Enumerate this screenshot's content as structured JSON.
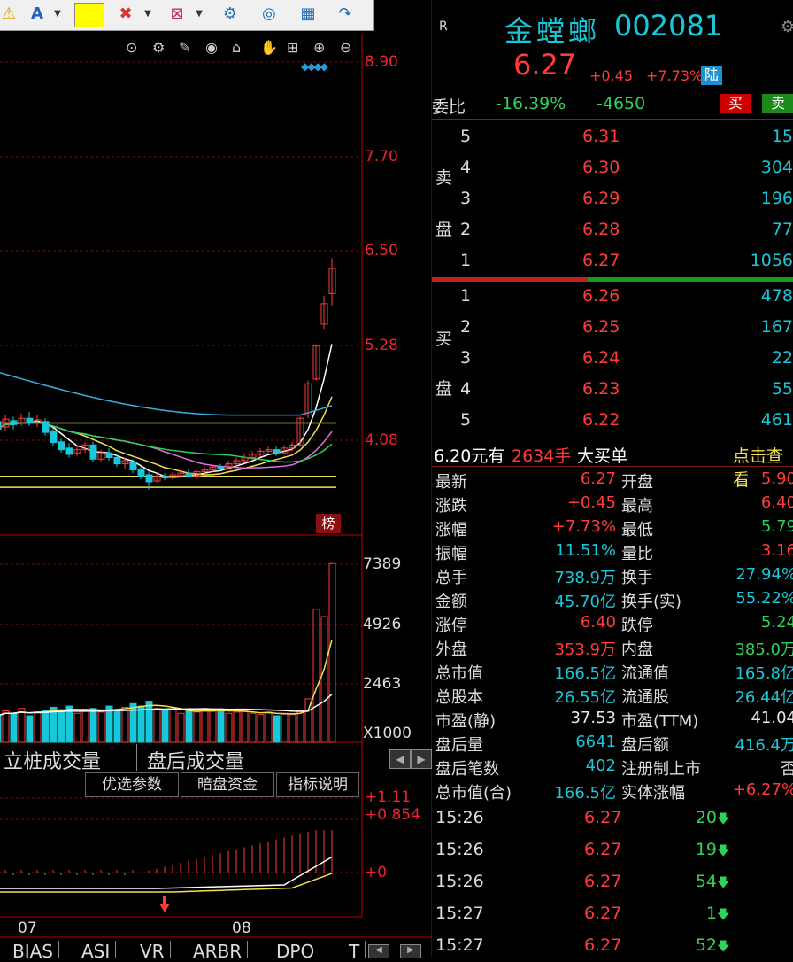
{
  "toolbar": {
    "items": [
      "A",
      "",
      "",
      "",
      "",
      "",
      "",
      ""
    ]
  },
  "chart": {
    "price_axis": [
      "8.90",
      "7.70",
      "6.50",
      "5.28",
      "4.08"
    ],
    "flag_label": "榜",
    "volume_axis": [
      "7389",
      "4926",
      "2463",
      "X1000"
    ],
    "volume_tabs": [
      "立桩成交量",
      "盘后成交量"
    ],
    "indicator_buttons": [
      "优选参数",
      "暗盘资金",
      "指标说明"
    ],
    "macd_axis": [
      "+1.11",
      "+0.854",
      "+0"
    ],
    "months": [
      "07",
      "08"
    ],
    "bottom_tabs": [
      "BIAS",
      "ASI",
      "VR",
      "ARBR",
      "DPO",
      "T"
    ],
    "colors": {
      "up": "#ff3b3b",
      "down": "#18c8d8",
      "ma5": "#ffffff",
      "ma10": "#f0e050",
      "ma20": "#e070e0",
      "ma30": "#2fd35a",
      "ma60": "#3ab0e0"
    },
    "chart_data": {
      "type": "candlestick",
      "price_ylim": [
        3.4,
        9.2
      ],
      "volume_ylim": [
        0,
        7800
      ],
      "candles": [
        {
          "o": 4.32,
          "c": 4.22,
          "h": 4.4,
          "l": 4.15
        },
        {
          "o": 4.25,
          "c": 4.35,
          "h": 4.4,
          "l": 4.2
        },
        {
          "o": 4.33,
          "c": 4.28,
          "h": 4.38,
          "l": 4.22
        },
        {
          "o": 4.3,
          "c": 4.36,
          "h": 4.42,
          "l": 4.26
        },
        {
          "o": 4.36,
          "c": 4.3,
          "h": 4.44,
          "l": 4.26
        },
        {
          "o": 4.3,
          "c": 4.34,
          "h": 4.4,
          "l": 4.25
        },
        {
          "o": 4.32,
          "c": 4.18,
          "h": 4.36,
          "l": 4.14
        },
        {
          "o": 4.2,
          "c": 4.05,
          "h": 4.24,
          "l": 4.0
        },
        {
          "o": 4.06,
          "c": 3.96,
          "h": 4.1,
          "l": 3.92
        },
        {
          "o": 3.98,
          "c": 3.9,
          "h": 4.04,
          "l": 3.86
        },
        {
          "o": 3.92,
          "c": 3.96,
          "h": 4.02,
          "l": 3.88
        },
        {
          "o": 3.96,
          "c": 4.02,
          "h": 4.06,
          "l": 3.92
        },
        {
          "o": 4.02,
          "c": 3.84,
          "h": 4.06,
          "l": 3.8
        },
        {
          "o": 3.84,
          "c": 3.92,
          "h": 3.96,
          "l": 3.8
        },
        {
          "o": 3.92,
          "c": 3.86,
          "h": 3.98,
          "l": 3.82
        },
        {
          "o": 3.86,
          "c": 3.78,
          "h": 3.9,
          "l": 3.74
        },
        {
          "o": 3.78,
          "c": 3.82,
          "h": 3.86,
          "l": 3.72
        },
        {
          "o": 3.8,
          "c": 3.7,
          "h": 3.84,
          "l": 3.66
        },
        {
          "o": 3.7,
          "c": 3.62,
          "h": 3.74,
          "l": 3.58
        },
        {
          "o": 3.64,
          "c": 3.55,
          "h": 3.68,
          "l": 3.45
        },
        {
          "o": 3.56,
          "c": 3.62,
          "h": 3.66,
          "l": 3.54
        },
        {
          "o": 3.62,
          "c": 3.6,
          "h": 3.66,
          "l": 3.57
        },
        {
          "o": 3.6,
          "c": 3.64,
          "h": 3.68,
          "l": 3.58
        },
        {
          "o": 3.63,
          "c": 3.66,
          "h": 3.7,
          "l": 3.6
        },
        {
          "o": 3.66,
          "c": 3.62,
          "h": 3.7,
          "l": 3.6
        },
        {
          "o": 3.62,
          "c": 3.68,
          "h": 3.72,
          "l": 3.6
        },
        {
          "o": 3.68,
          "c": 3.7,
          "h": 3.74,
          "l": 3.65
        },
        {
          "o": 3.7,
          "c": 3.74,
          "h": 3.78,
          "l": 3.67
        },
        {
          "o": 3.74,
          "c": 3.72,
          "h": 3.78,
          "l": 3.7
        },
        {
          "o": 3.72,
          "c": 3.78,
          "h": 3.82,
          "l": 3.7
        },
        {
          "o": 3.78,
          "c": 3.82,
          "h": 3.86,
          "l": 3.75
        },
        {
          "o": 3.82,
          "c": 3.86,
          "h": 3.9,
          "l": 3.79
        },
        {
          "o": 3.86,
          "c": 3.9,
          "h": 3.94,
          "l": 3.83
        },
        {
          "o": 3.9,
          "c": 3.94,
          "h": 3.98,
          "l": 3.87
        },
        {
          "o": 3.94,
          "c": 3.96,
          "h": 4.0,
          "l": 3.9
        },
        {
          "o": 3.96,
          "c": 3.92,
          "h": 4.0,
          "l": 3.88
        },
        {
          "o": 3.92,
          "c": 3.98,
          "h": 4.02,
          "l": 3.9
        },
        {
          "o": 3.98,
          "c": 4.02,
          "h": 4.06,
          "l": 3.94
        },
        {
          "o": 4.02,
          "c": 4.36,
          "h": 4.38,
          "l": 4.0
        },
        {
          "o": 4.4,
          "c": 4.8,
          "h": 4.84,
          "l": 4.36
        },
        {
          "o": 4.86,
          "c": 5.28,
          "h": 5.3,
          "l": 4.84
        },
        {
          "o": 5.56,
          "c": 5.82,
          "h": 5.92,
          "l": 5.5
        },
        {
          "o": 5.95,
          "c": 6.27,
          "h": 6.4,
          "l": 5.79
        }
      ],
      "volumes": [
        1100,
        1300,
        1200,
        1400,
        1100,
        1250,
        1300,
        1450,
        1350,
        1500,
        1200,
        1300,
        1400,
        1250,
        1500,
        1350,
        1450,
        1600,
        1500,
        1700,
        1400,
        1300,
        1350,
        1200,
        1300,
        1250,
        1400,
        1300,
        1350,
        1200,
        1250,
        1300,
        1200,
        1150,
        1250,
        1100,
        1200,
        1150,
        1300,
        1800,
        5500,
        5200,
        7389
      ],
      "horizontal_lines": [
        4.3,
        3.62,
        3.48
      ]
    }
  },
  "quote": {
    "marker": "R",
    "name": "金螳螂",
    "code": "002081",
    "price": "6.27",
    "change": "+0.45",
    "change_pct": "+7.73%",
    "badge": "陆",
    "webi_label": "委比",
    "webi_pct": "-16.39%",
    "webi_diff": "-4650",
    "buy_btn": "买",
    "sell_btn": "卖",
    "sell_side_label": [
      "卖",
      "盘"
    ],
    "buy_side_label": [
      "买",
      "盘"
    ],
    "asks": [
      {
        "lvl": "5",
        "price": "6.31",
        "vol": "15"
      },
      {
        "lvl": "4",
        "price": "6.30",
        "vol": "304"
      },
      {
        "lvl": "3",
        "price": "6.29",
        "vol": "196"
      },
      {
        "lvl": "2",
        "price": "6.28",
        "vol": "77"
      },
      {
        "lvl": "1",
        "price": "6.27",
        "vol": "1056"
      }
    ],
    "bids": [
      {
        "lvl": "1",
        "price": "6.26",
        "vol": "478"
      },
      {
        "lvl": "2",
        "price": "6.25",
        "vol": "167"
      },
      {
        "lvl": "3",
        "price": "6.24",
        "vol": "22"
      },
      {
        "lvl": "4",
        "price": "6.23",
        "vol": "55"
      },
      {
        "lvl": "5",
        "price": "6.22",
        "vol": "461"
      }
    ],
    "big_order": {
      "a": "6.20元有",
      "b": "2634手",
      "c": "大买单",
      "d": "点击查看"
    },
    "stats": [
      {
        "l": "最新",
        "v": "6.27",
        "vc": "red",
        "l2": "开盘",
        "v2": "5.90",
        "v2c": "red"
      },
      {
        "l": "涨跌",
        "v": "+0.45",
        "vc": "red",
        "l2": "最高",
        "v2": "6.40",
        "v2c": "red"
      },
      {
        "l": "涨幅",
        "v": "+7.73%",
        "vc": "red",
        "l2": "最低",
        "v2": "5.79",
        "v2c": "green"
      },
      {
        "l": "振幅",
        "v": "11.51%",
        "vc": "cyan",
        "l2": "量比",
        "v2": "3.16",
        "v2c": "red"
      },
      {
        "l": "总手",
        "v": "738.9万",
        "vc": "cyan",
        "l2": "换手",
        "v2": "27.94%",
        "v2c": "cyan"
      },
      {
        "l": "金额",
        "v": "45.70亿",
        "vc": "cyan",
        "l2": "换手(实)",
        "v2": "55.22%",
        "v2c": "cyan"
      },
      {
        "l": "涨停",
        "v": "6.40",
        "vc": "red",
        "l2": "跌停",
        "v2": "5.24",
        "v2c": "green"
      },
      {
        "l": "外盘",
        "v": "353.9万",
        "vc": "red",
        "l2": "内盘",
        "v2": "385.0万",
        "v2c": "green"
      },
      {
        "l": "总市值",
        "v": "166.5亿",
        "vc": "cyan",
        "l2": "流通值",
        "v2": "165.8亿",
        "v2c": "cyan"
      },
      {
        "l": "总股本",
        "v": "26.55亿",
        "vc": "cyan",
        "l2": "流通股",
        "v2": "26.44亿",
        "v2c": "cyan"
      },
      {
        "l": "市盈(静)",
        "v": "37.53",
        "vc": "white",
        "l2": "市盈(TTM)",
        "v2": "41.04",
        "v2c": "white"
      },
      {
        "l": "盘后量",
        "v": "6641",
        "vc": "cyan",
        "l2": "盘后额",
        "v2": "416.4万",
        "v2c": "cyan"
      },
      {
        "l": "盘后笔数",
        "v": "402",
        "vc": "cyan",
        "l2": "注册制上市",
        "v2": "否",
        "v2c": "white"
      },
      {
        "l": "总市值(合)",
        "v": "166.5亿",
        "vc": "cyan",
        "l2": "实体涨幅",
        "v2": "+6.27%",
        "v2c": "red"
      }
    ],
    "ticks": [
      {
        "t": "15:26",
        "p": "6.27",
        "v": "20"
      },
      {
        "t": "15:26",
        "p": "6.27",
        "v": "19"
      },
      {
        "t": "15:26",
        "p": "6.27",
        "v": "54"
      },
      {
        "t": "15:27",
        "p": "6.27",
        "v": "1"
      },
      {
        "t": "15:27",
        "p": "6.27",
        "v": "52"
      }
    ]
  }
}
